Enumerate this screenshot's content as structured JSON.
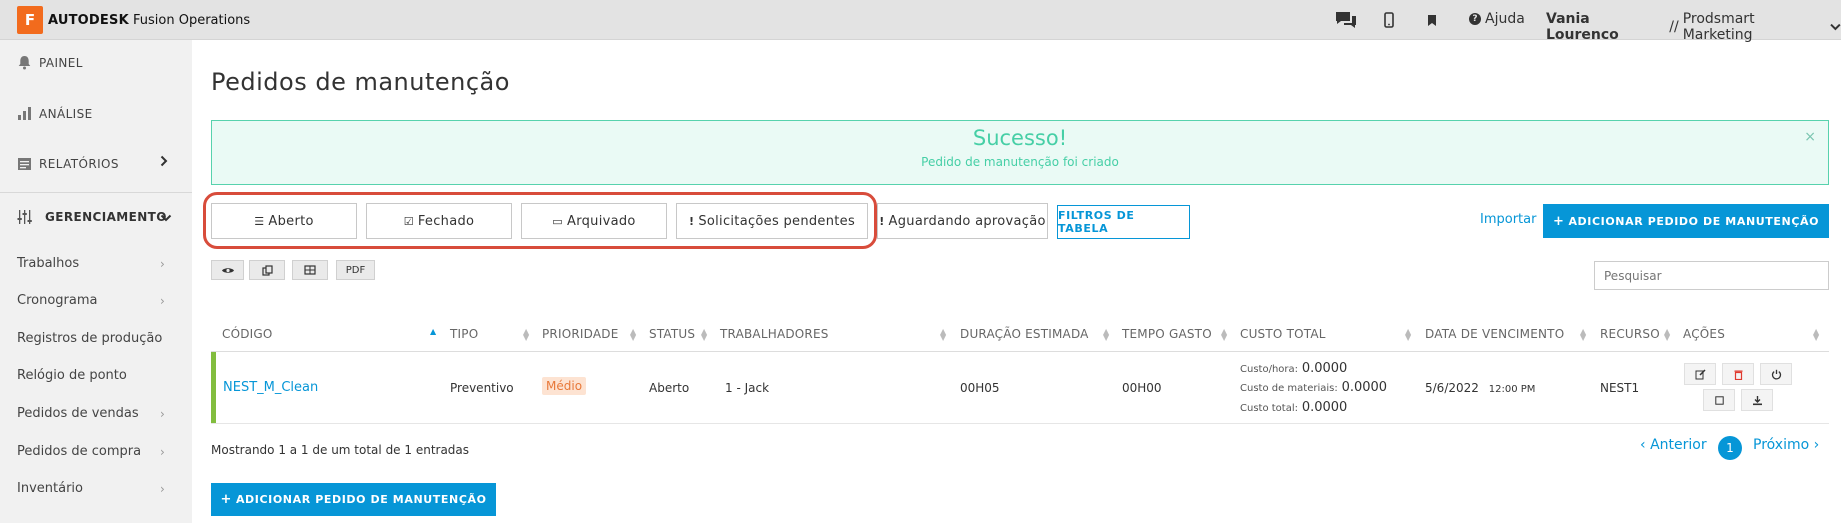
{
  "topbar": {
    "logo_letter": "F",
    "brand": "AUTODESK",
    "product": "Fusion Operations",
    "icons": [
      "chat-icon",
      "mobile-icon",
      "bookmark-icon",
      "help-icon"
    ],
    "help_label": "Ajuda",
    "user_name": "Vania Lourenco",
    "user_separator": "//",
    "company": "Prodsmart Marketing"
  },
  "sidebar": {
    "main_items": [
      {
        "label": "PAINEL",
        "icon": "bell-icon"
      },
      {
        "label": "ANÁLISE",
        "icon": "bar-chart-icon"
      },
      {
        "label": "RELATÓRIOS",
        "icon": "report-icon"
      },
      {
        "label": "GERENCIAMENTO",
        "icon": "sliders-icon"
      }
    ],
    "sub_items": [
      {
        "label": "Trabalhos",
        "has_arrow": true
      },
      {
        "label": "Cronograma",
        "has_arrow": true
      },
      {
        "label": "Registros de produção",
        "has_arrow": false
      },
      {
        "label": "Relógio de ponto",
        "has_arrow": false
      },
      {
        "label": "Pedidos de vendas",
        "has_arrow": true
      },
      {
        "label": "Pedidos de compra",
        "has_arrow": true
      },
      {
        "label": "Inventário",
        "has_arrow": true
      }
    ]
  },
  "main": {
    "title": "Pedidos de manutenção",
    "alert": {
      "title": "Sucesso!",
      "message": "Pedido de manutenção foi criado",
      "close": "×"
    },
    "tabs": [
      {
        "label": "Aberto",
        "icon": "list-icon"
      },
      {
        "label": "Fechado",
        "icon": "check-square-icon"
      },
      {
        "label": "Arquivado",
        "icon": "inbox-icon"
      },
      {
        "label": "Solicitações pendentes",
        "icon": "exclamation-icon"
      },
      {
        "label": "Aguardando aprovação",
        "icon": "exclamation-icon"
      }
    ],
    "filter_button": "FILTROS DE TABELA",
    "import_link": "Importar",
    "add_button": "ADICIONAR PEDIDO DE MANUTENÇÃO",
    "tools": {
      "pdf": "PDF"
    },
    "search_placeholder": "Pesquisar"
  },
  "table": {
    "columns": [
      "CÓDIGO",
      "TIPO",
      "PRIORIDADE",
      "STATUS",
      "TRABALHADORES",
      "DURAÇÃO ESTIMADA",
      "TEMPO GASTO",
      "CUSTO TOTAL",
      "DATA DE VENCIMENTO",
      "RECURSO",
      "AÇÕES"
    ],
    "rows": [
      {
        "code": "NEST_M_Clean",
        "type": "Preventivo",
        "priority": "Médio",
        "status": "Aberto",
        "workers": "1 - Jack",
        "estimated": "00H05",
        "spent": "00H00",
        "cost_hour_label": "Custo/hora:",
        "cost_hour": "0.0000",
        "cost_materials_label": "Custo de materiais:",
        "cost_materials": "0.0000",
        "cost_total_label": "Custo total:",
        "cost_total": "0.0000",
        "due_date": "5/6/2022",
        "due_time": "12:00 PM",
        "resource": "NEST1"
      }
    ],
    "priority_color": "#e8793a"
  },
  "footer": {
    "info": "Mostrando 1 a 1 de um total de 1 entradas",
    "previous": "Anterior",
    "page": "1",
    "next": "Próximo",
    "add_button": "ADICIONAR PEDIDO DE MANUTENÇÃO"
  },
  "colors": {
    "accent": "#0696d7",
    "success": "#46cfa6",
    "highlight": "#d84c3b",
    "row_marker": "#82bd3e"
  }
}
